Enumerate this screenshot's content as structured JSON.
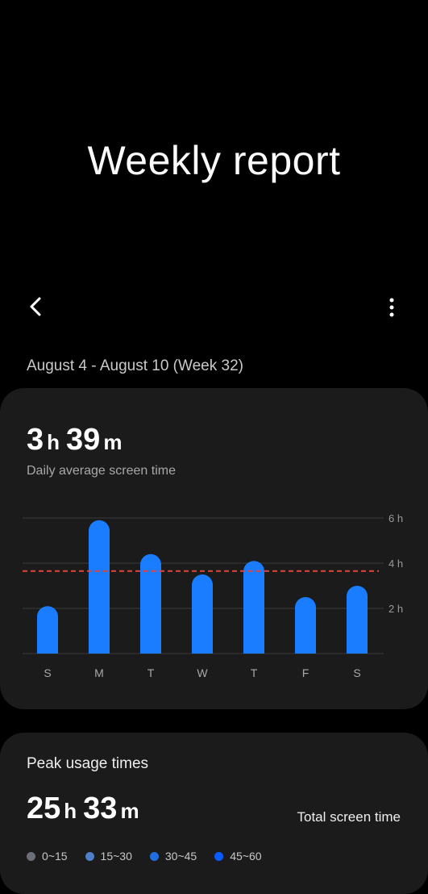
{
  "header": {
    "title": "Weekly report",
    "back_icon": "back-arrow-icon",
    "more_icon": "more-vert-icon"
  },
  "week_label": "August 4 - August 10 (Week 32)",
  "daily_average": {
    "hours": "3",
    "hours_unit": "h",
    "minutes": "39",
    "minutes_unit": "m",
    "label": "Daily average screen time"
  },
  "chart_data": {
    "type": "bar",
    "categories": [
      "S",
      "M",
      "T",
      "W",
      "T",
      "F",
      "S"
    ],
    "values": [
      2.1,
      5.9,
      4.4,
      3.5,
      4.1,
      2.5,
      3.0
    ],
    "average": 3.65,
    "ylim": [
      0,
      6
    ],
    "yticks": [
      2,
      4,
      6
    ],
    "ytick_labels": [
      "2 h",
      "4 h",
      "6 h"
    ],
    "bar_color": "#1a7dff",
    "average_line_color": "#e0443b",
    "grid": true
  },
  "peak": {
    "label": "Peak usage times",
    "total_hours": "25",
    "total_hours_unit": "h",
    "total_minutes": "33",
    "total_minutes_unit": "m",
    "total_label": "Total screen time",
    "legend": [
      {
        "label": "0~15",
        "color": "#6d6f78"
      },
      {
        "label": "15~30",
        "color": "#4f7fc9"
      },
      {
        "label": "30~45",
        "color": "#1f6fe0"
      },
      {
        "label": "45~60",
        "color": "#0a5cff"
      }
    ]
  }
}
